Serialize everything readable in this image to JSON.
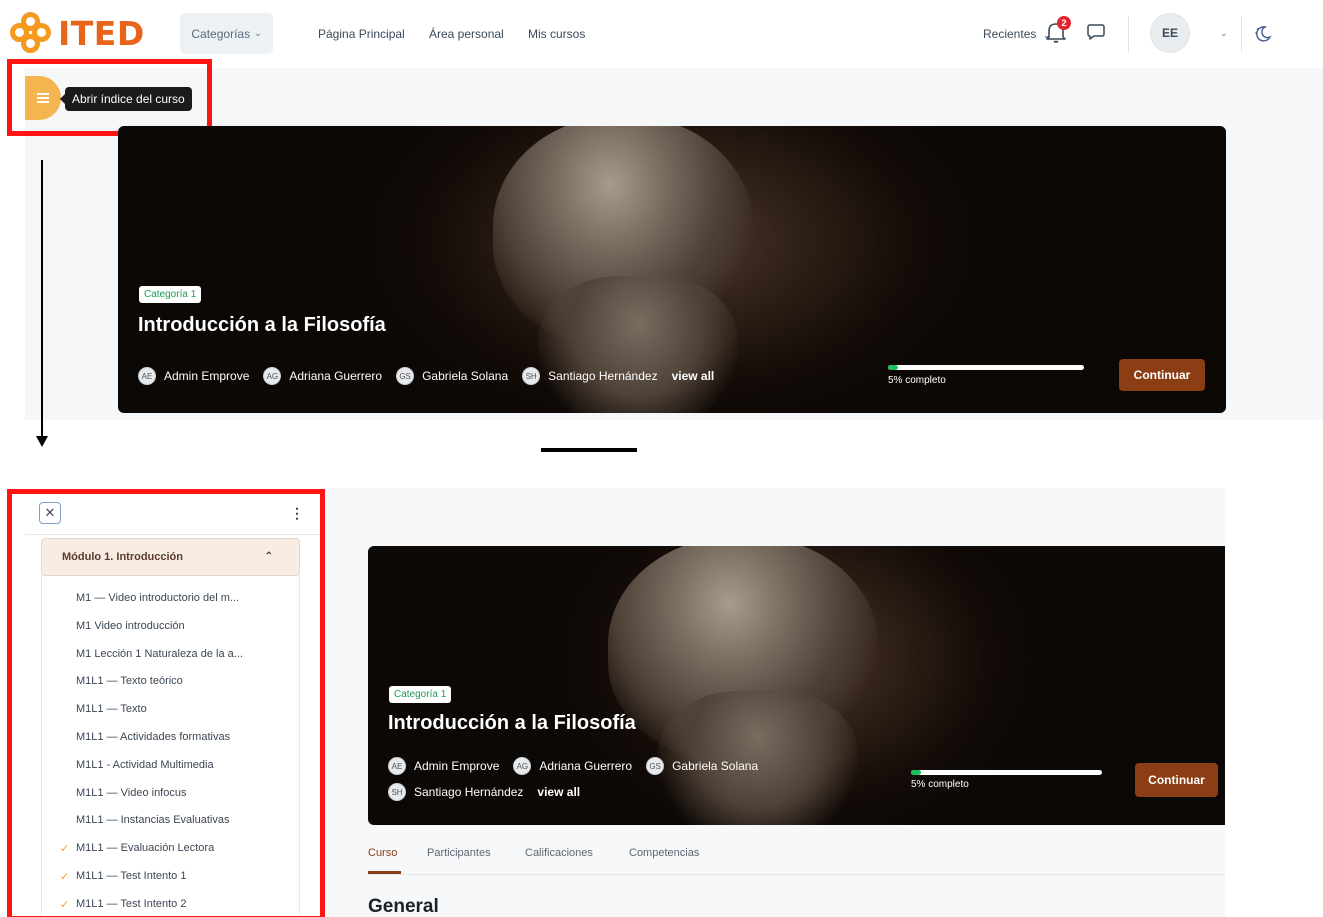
{
  "topnav": {
    "logo_text": "ITED",
    "categories_label": "Categorías",
    "links": [
      "Página Principal",
      "Área personal",
      "Mis cursos"
    ],
    "recent_label": "Recientes",
    "notification_count": "2",
    "avatar_initials": "EE"
  },
  "tooltip": "Abrir índice del curso",
  "course": {
    "category": "Categoría 1",
    "title": "Introducción a la Filosofía",
    "teachers": [
      {
        "initials": "AE",
        "name": "Admin Emprove"
      },
      {
        "initials": "AG",
        "name": "Adriana Guerrero"
      },
      {
        "initials": "GS",
        "name": "Gabriela Solana"
      },
      {
        "initials": "SH",
        "name": "Santiago Hernández"
      }
    ],
    "view_all": "view all",
    "progress_percent": 5,
    "progress_label": "5% completo",
    "continue_label": "Continuar"
  },
  "sidebar": {
    "close_symbol": "✕",
    "menu_symbol": "⋮",
    "module_title": "Módulo 1. Introducción",
    "items": [
      {
        "label": "M1 — Video introductorio del m...",
        "done": false
      },
      {
        "label": "M1 Video introducción",
        "done": false
      },
      {
        "label": "M1 Lección 1 Naturaleza de la a...",
        "done": false
      },
      {
        "label": "M1L1 — Texto teórico",
        "done": false
      },
      {
        "label": "M1L1 — Texto",
        "done": false
      },
      {
        "label": "M1L1 — Actividades formativas",
        "done": false
      },
      {
        "label": "M1L1 - Actividad Multimedia",
        "done": false
      },
      {
        "label": "M1L1 — Video infocus",
        "done": false
      },
      {
        "label": "M1L1 — Instancias Evaluativas",
        "done": false
      },
      {
        "label": "M1L1 — Evaluación Lectora",
        "done": true
      },
      {
        "label": "M1L1 — Test Intento 1",
        "done": true
      },
      {
        "label": "M1L1 — Test Intento 2",
        "done": true
      }
    ]
  },
  "tabs": [
    "Curso",
    "Participantes",
    "Calificaciones",
    "Competencias"
  ],
  "section_title": "General",
  "colors": {
    "accent": "#8b3d14",
    "logo_orange": "#e8641b",
    "drawer_button": "#f4b450",
    "highlight_red": "#ff1414",
    "progress_green": "#1dbf5f"
  },
  "icons": [
    "hamburger-icon",
    "bell-icon",
    "chat-icon",
    "theme-toggle-icon",
    "close-icon",
    "kebab-icon",
    "check-icon",
    "chevron-down-icon",
    "chevron-up-icon",
    "arrow-down-icon"
  ]
}
